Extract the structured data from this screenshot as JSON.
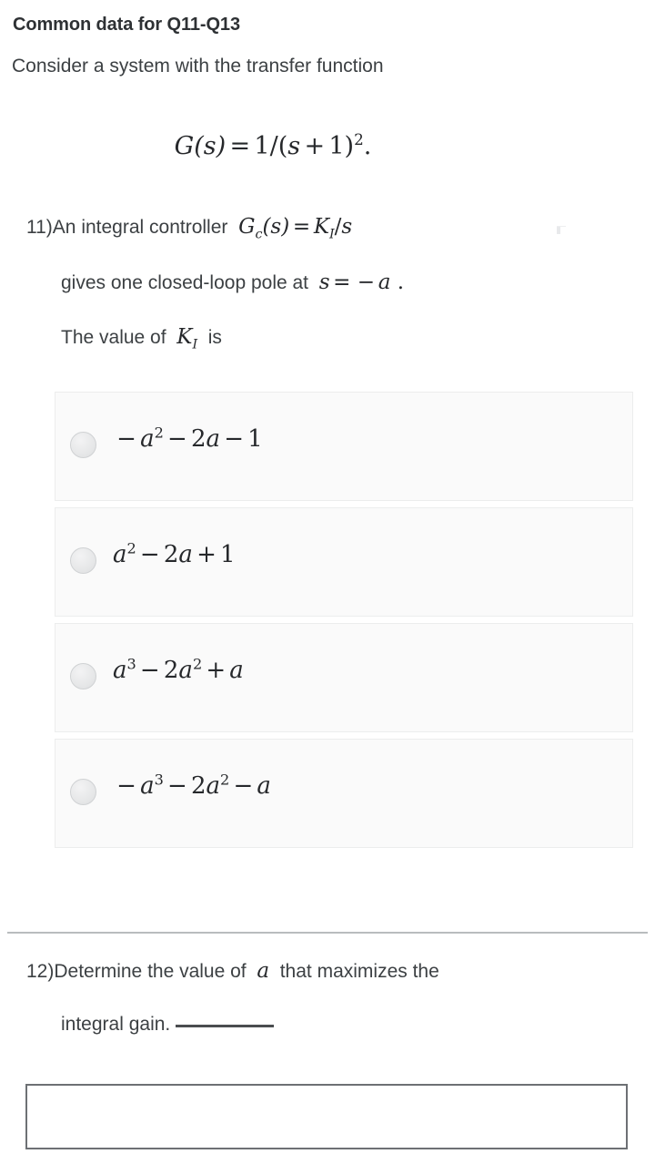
{
  "common": {
    "heading": "Common data for Q11-Q13",
    "body": "Consider a system with the transfer function",
    "formula_plain": "G(s) = 1/(s + 1)²."
  },
  "question11": {
    "number": "11)",
    "line1_text": "An integral controller",
    "line1_math": "G_c(s) = K_I/s",
    "line2_text": "gives one closed-loop pole at",
    "line2_math": "s = −a .",
    "line3_prefix": "The value of",
    "line3_math": "K_I",
    "line3_suffix": "is",
    "options": [
      {
        "id": "option-a",
        "text": "−a² − 2a − 1",
        "selected": false
      },
      {
        "id": "option-b",
        "text": "a² − 2a + 1",
        "selected": false
      },
      {
        "id": "option-c",
        "text": "a³ − 2a² + a",
        "selected": false
      },
      {
        "id": "option-d",
        "text": "−a³ − 2a² − a",
        "selected": false
      }
    ]
  },
  "question12": {
    "number": "12)",
    "line1_prefix": "Determine the value of",
    "line1_math": "a",
    "line1_suffix": "that maximizes the",
    "line2": "integral gain.",
    "answer_value": "",
    "answer_placeholder": ""
  },
  "colors": {
    "text": "#3c4043",
    "math": "#26282b",
    "option_bg": "#fafafa",
    "option_border": "#eceded",
    "divider": "#b9bcbe",
    "input_border": "#6d7074",
    "radio_fill": "#e6e7e8"
  }
}
